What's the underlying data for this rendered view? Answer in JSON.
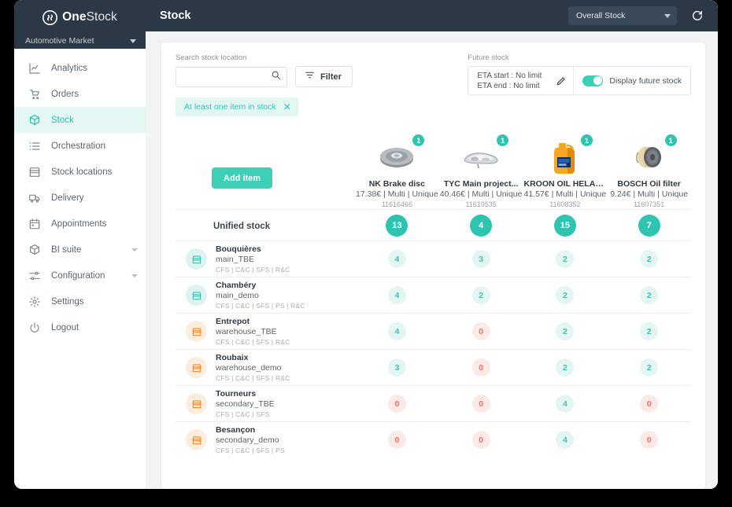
{
  "brand": {
    "name_bold": "One",
    "name_light": "Stock",
    "logo_icon": "onestock-logo-icon"
  },
  "market_selector": {
    "label": "Automotive Market",
    "icon": "chevron-down-icon"
  },
  "sidebar": {
    "items": [
      {
        "label": "Analytics",
        "icon": "analytics-chart-icon",
        "active": false,
        "has_caret": false
      },
      {
        "label": "Orders",
        "icon": "cart-icon",
        "active": false,
        "has_caret": false
      },
      {
        "label": "Stock",
        "icon": "box-icon",
        "active": true,
        "has_caret": false
      },
      {
        "label": "Orchestration",
        "icon": "list-icon",
        "active": false,
        "has_caret": false
      },
      {
        "label": "Stock locations",
        "icon": "store-icon",
        "active": false,
        "has_caret": false
      },
      {
        "label": "Delivery",
        "icon": "truck-icon",
        "active": false,
        "has_caret": false
      },
      {
        "label": "Appointments",
        "icon": "calendar-icon",
        "active": false,
        "has_caret": false
      },
      {
        "label": "BI suite",
        "icon": "box-icon",
        "active": false,
        "has_caret": true
      },
      {
        "label": "Configuration",
        "icon": "sliders-icon",
        "active": false,
        "has_caret": true
      },
      {
        "label": "Settings",
        "icon": "gear-icon",
        "active": false,
        "has_caret": false
      },
      {
        "label": "Logout",
        "icon": "power-icon",
        "active": false,
        "has_caret": false
      }
    ]
  },
  "topbar": {
    "title": "Stock",
    "stock_selector": {
      "value": "Overall Stock",
      "icon": "chevron-down-icon"
    },
    "refresh": {
      "icon": "refresh-icon"
    }
  },
  "toolbar": {
    "search_label": "Search stock location",
    "search_value": "",
    "search_placeholder": "",
    "search_icon": "search-icon",
    "filter_label": "Filter",
    "filter_icon": "filter-icon",
    "chip_label": "At least one item in stock",
    "chip_close_icon": "close-icon"
  },
  "future_stock": {
    "label": "Future stock",
    "eta_start": "ETA start : No limit",
    "eta_end": "ETA end : No limit",
    "edit_icon": "pencil-icon",
    "toggle_label": "Display future stock",
    "toggle_on": true
  },
  "grid": {
    "add_item_label": "Add item",
    "unified_label": "Unified stock",
    "products": [
      {
        "name": "NK Brake disc",
        "meta": "17.38€ | Multi | Unique",
        "sku": "11616466",
        "badge": "1",
        "image": "brake-disc-image"
      },
      {
        "name": "TYC Main project...",
        "meta": "40.46€ | Multi | Unique",
        "sku": "11619535",
        "badge": "1",
        "image": "headlight-image"
      },
      {
        "name": "KROON OIL HELAR ...",
        "meta": "41.57€ | Multi | Unique",
        "sku": "11608352",
        "badge": "1",
        "image": "oil-can-image"
      },
      {
        "name": "BOSCH Oil filter",
        "meta": "9.24€ | Multi | Unique",
        "sku": "11607351",
        "badge": "1",
        "image": "oil-filter-image"
      }
    ],
    "unified_values": [
      "13",
      "4",
      "15",
      "7"
    ],
    "rows": [
      {
        "name": "Bouquières",
        "code": "main_TBE",
        "tags": "CFS | C&C | SFS | R&C",
        "kind": "main",
        "icon": "store-icon",
        "values": [
          "4",
          "3",
          "2",
          "2"
        ]
      },
      {
        "name": "Chambéry",
        "code": "main_demo",
        "tags": "CFS | C&C | SFS | PS | R&C",
        "kind": "main",
        "icon": "store-icon",
        "values": [
          "4",
          "2",
          "2",
          "2"
        ]
      },
      {
        "name": "Entrepot",
        "code": "warehouse_TBE",
        "tags": "CFS | C&C | SFS | R&C",
        "kind": "warehouse",
        "icon": "store-icon",
        "values": [
          "4",
          "0",
          "2",
          "2"
        ]
      },
      {
        "name": "Roubaix",
        "code": "warehouse_demo",
        "tags": "CFS | C&C | SFS | R&C",
        "kind": "warehouse",
        "icon": "store-icon",
        "values": [
          "3",
          "0",
          "2",
          "2"
        ]
      },
      {
        "name": "Tourneurs",
        "code": "secondary_TBE",
        "tags": "CFS | C&C | SFS",
        "kind": "warehouse",
        "icon": "store-icon",
        "values": [
          "0",
          "0",
          "4",
          "0"
        ]
      },
      {
        "name": "Besançon",
        "code": "secondary_demo",
        "tags": "CFS | C&C | SFS | PS",
        "kind": "warehouse",
        "icon": "store-icon",
        "values": [
          "0",
          "0",
          "4",
          "0"
        ]
      }
    ]
  },
  "colors": {
    "accent": "#3ecfb7",
    "accent_strong": "#2ec4b0",
    "danger": "#f4705a",
    "sidebar_dark": "#2b3845",
    "warehouse": "#f5862a"
  }
}
